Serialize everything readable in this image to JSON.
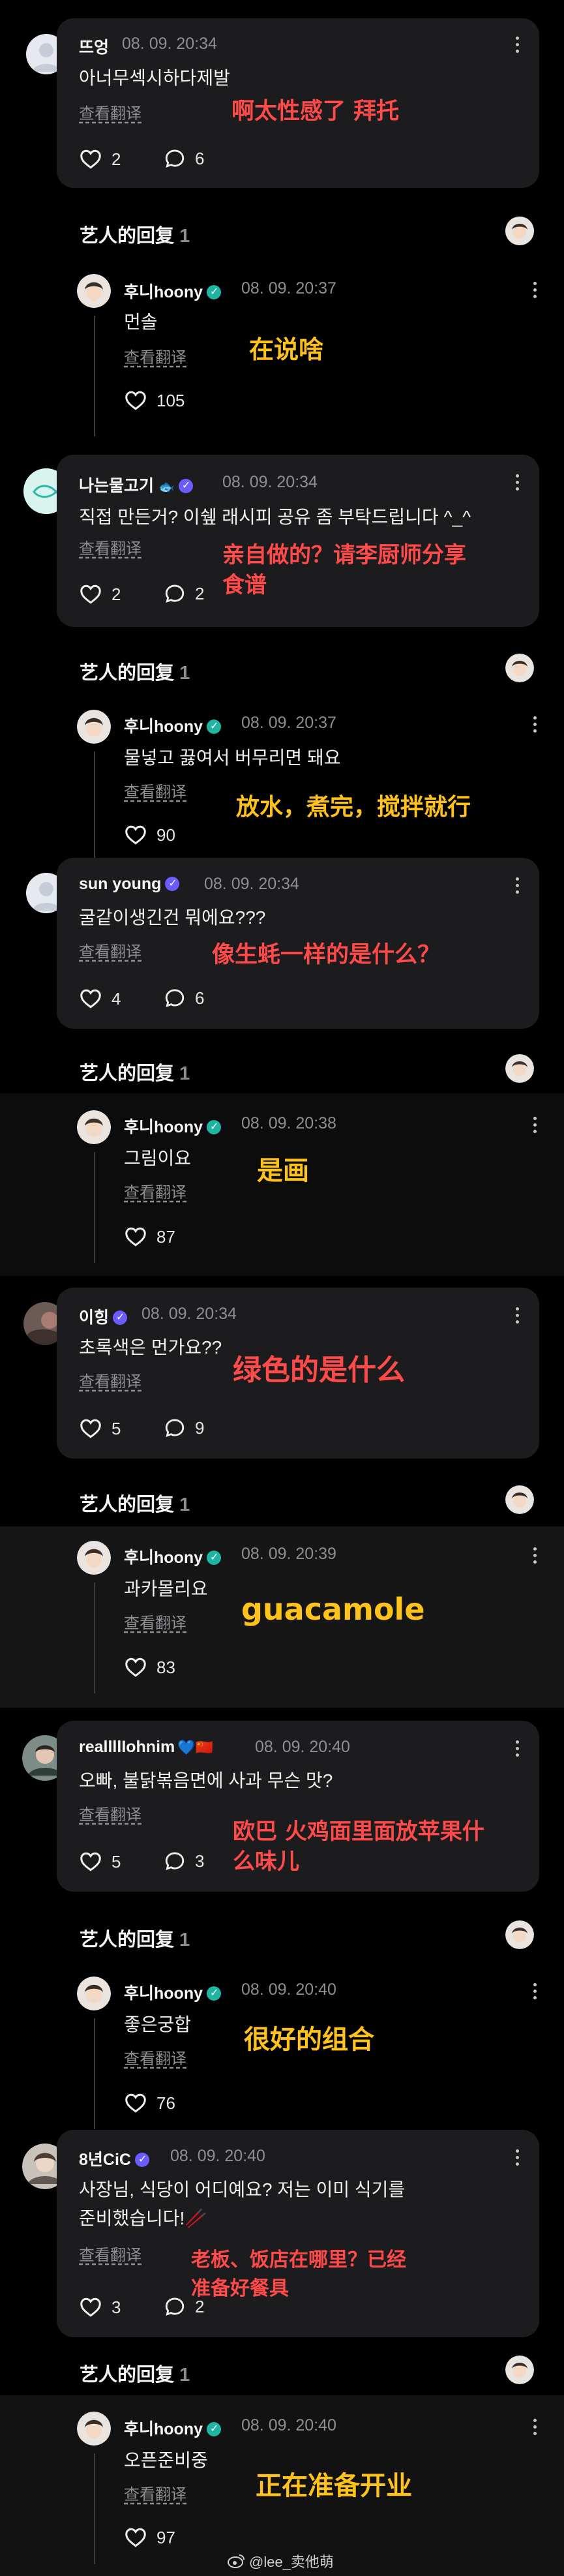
{
  "replies_header": {
    "label": "艺人的回复",
    "count": "1"
  },
  "translate_label": "查看翻译",
  "comments": [
    {
      "name": "뜨엉",
      "time": "08. 09. 20:34",
      "text": "아너무섹시하다제발",
      "likes": "2",
      "replies": "6",
      "overlay": "啊太性感了 拜托"
    },
    {
      "name": "나는물고기",
      "time": "08. 09. 20:34",
      "text": "직접 만든거? 이쉪 래시피 공유 좀 부탁드립니다 ^_^",
      "likes": "2",
      "replies": "2",
      "overlay_line1": "亲自做的？请李厨师分享",
      "overlay_line2": "食谱"
    },
    {
      "name": "sun young",
      "time": "08. 09. 20:34",
      "text": "굴같이생긴건 뭐에요???",
      "likes": "4",
      "replies": "6",
      "overlay": "像生蚝一样的是什么？"
    },
    {
      "name": "이힝",
      "time": "08. 09. 20:34",
      "text": "초록색은 먼가요??",
      "likes": "5",
      "replies": "9",
      "overlay": "绿色的是什么"
    },
    {
      "name": "reallllIohnim",
      "flag": "💙🇨🇳",
      "time": "08. 09. 20:40",
      "text": "오빠, 불닭볶음면에 사과 무슨 맛?",
      "likes": "5",
      "replies": "3",
      "overlay_line1": "欧巴 火鸡面里面放苹果什",
      "overlay_line2": "么味儿"
    },
    {
      "name": "8년CiC",
      "time": "08. 09. 20:40",
      "text_line1": "사장님, 식당이 어디예요? 저는 이미 식기를",
      "text_line2": "준비했습니다!🥢",
      "likes": "3",
      "replies": "2",
      "overlay_line1": "老板、饭店在哪里？已经",
      "overlay_line2": "准备好餐具"
    }
  ],
  "artist_replies": [
    {
      "name": "후니hoony",
      "time": "08. 09. 20:37",
      "text": "먼솔",
      "likes": "105",
      "overlay": "在说啥"
    },
    {
      "name": "후니hoony",
      "time": "08. 09. 20:37",
      "text": "물넣고 끓여서 버무리면 돼요",
      "likes": "90",
      "overlay": "放水，煮完，搅拌就行"
    },
    {
      "name": "후니hoony",
      "time": "08. 09. 20:38",
      "text": "그림이요",
      "likes": "87",
      "overlay": "是画"
    },
    {
      "name": "후니hoony",
      "time": "08. 09. 20:39",
      "text": "과카몰리요",
      "likes": "83",
      "overlay": "guacamole"
    },
    {
      "name": "후니hoony",
      "time": "08. 09. 20:40",
      "text": "좋은궁합",
      "likes": "76",
      "overlay": "很好的组合"
    },
    {
      "name": "후니hoony",
      "time": "08. 09. 20:40",
      "text": "오픈준비중",
      "likes": "97",
      "overlay": "正在准备开业"
    }
  ],
  "watermark": "@lee_卖他萌",
  "colors": {
    "overlay_red": "#ff4a4a",
    "overlay_yellow": "#ffc21a",
    "card_bg": "#1c1c1e",
    "verified_teal": "#1fb5a3",
    "verified_purple": "#6a5cff"
  }
}
